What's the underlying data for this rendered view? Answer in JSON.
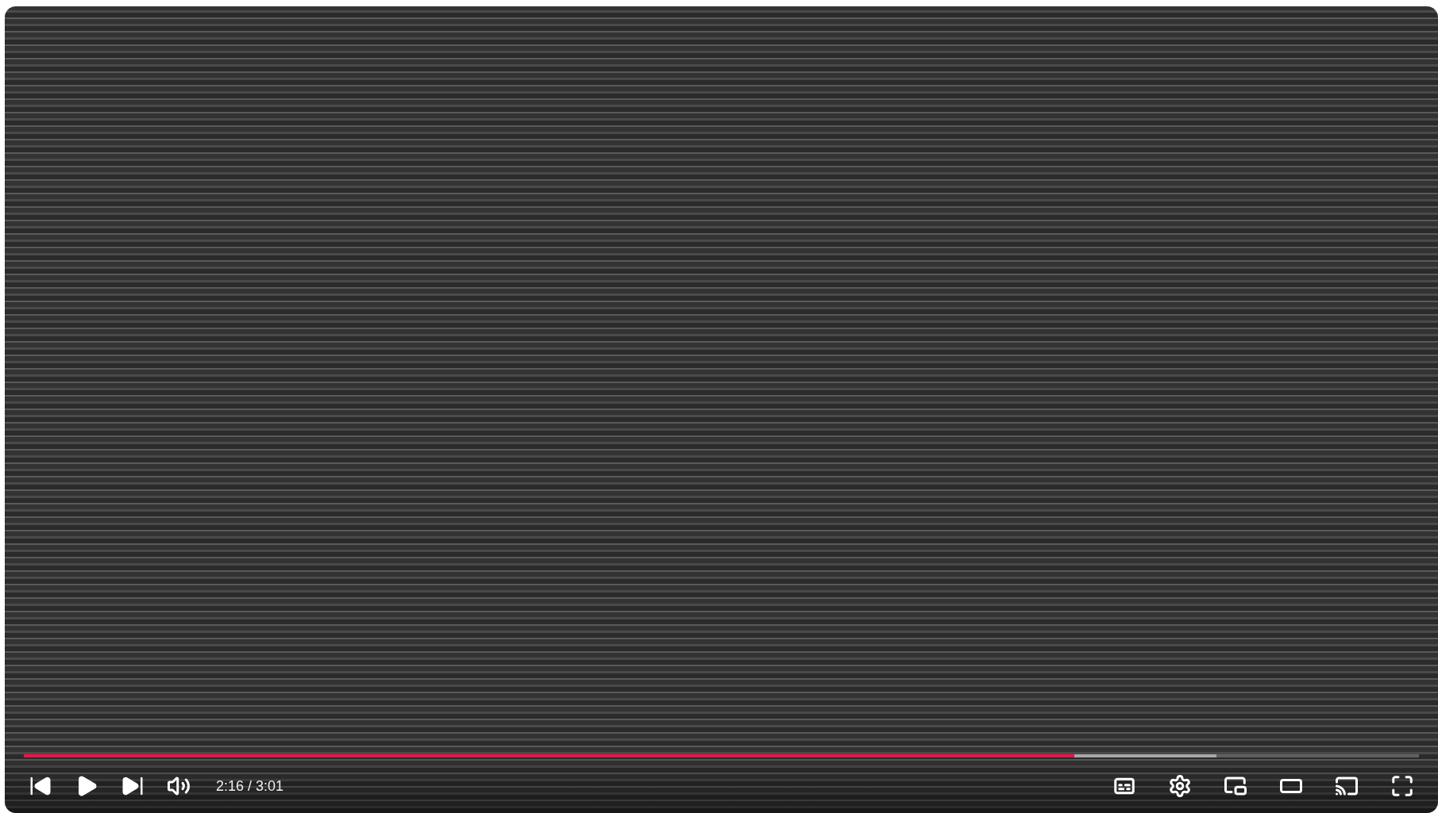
{
  "player": {
    "progress": {
      "level": 0.753
    },
    "buffer": {
      "level": 0.855
    },
    "time": "2:16 / 3:01"
  }
}
